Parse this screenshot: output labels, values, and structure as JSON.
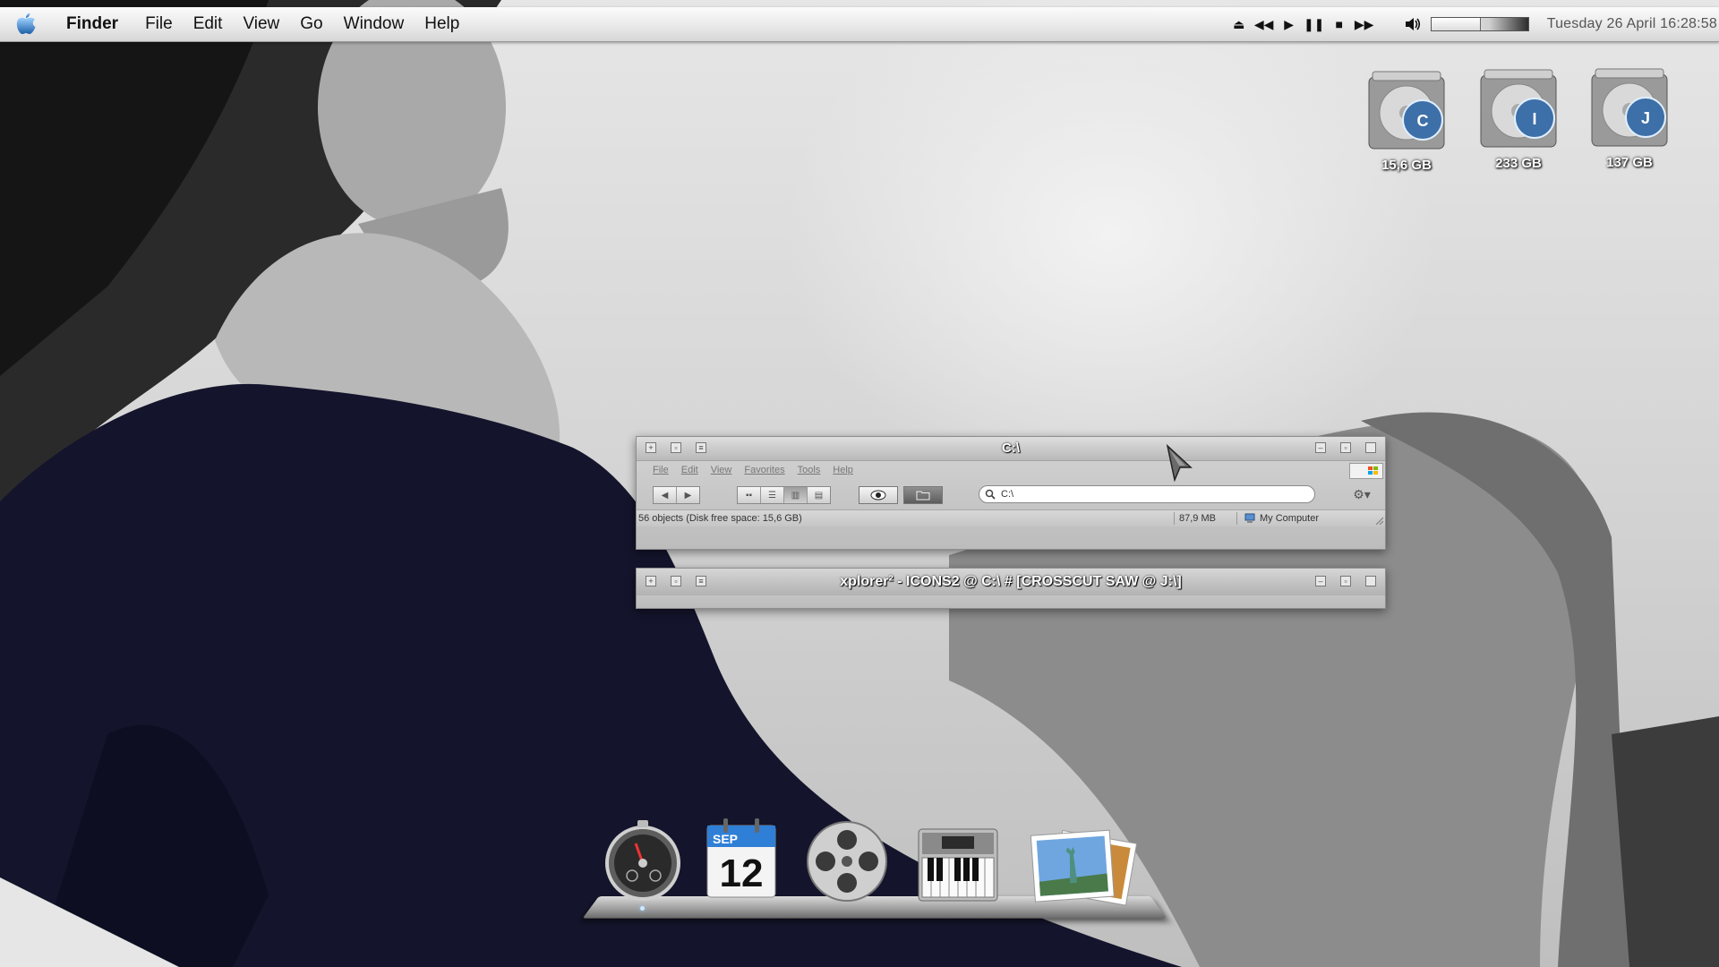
{
  "menubar": {
    "app_name": "Finder",
    "items": [
      "File",
      "Edit",
      "View",
      "Go",
      "Window",
      "Help"
    ],
    "clock": "Tuesday 26 April 16:28:58",
    "volume_level": 0.5,
    "media_controls": [
      "eject-icon",
      "rewind-icon",
      "play-icon",
      "pause-icon",
      "stop-icon",
      "fast-forward-icon"
    ]
  },
  "desktop": {
    "drives": [
      {
        "letter": "C",
        "size": "15,6 GB"
      },
      {
        "letter": "I",
        "size": "233 GB"
      },
      {
        "letter": "J",
        "size": "137 GB"
      }
    ]
  },
  "explorer": {
    "title": "C:\\",
    "menu": [
      "File",
      "Edit",
      "View",
      "Favorites",
      "Tools",
      "Help"
    ],
    "address": "C:\\",
    "status": {
      "objects": "56 objects (Disk free space: 15,6 GB)",
      "size": "87,9 MB",
      "location": "My Computer"
    }
  },
  "xplorer": {
    "title": "xplorer² - ICONS2 @ C:\\ # [CROSSCUT SAW @ J:\\]"
  },
  "dock": {
    "calendar_month": "SEP",
    "calendar_day": "12",
    "items": [
      "dashboard-icon",
      "calendar-icon",
      "film-reel-icon",
      "piano-keyboard-icon",
      "photos-icon"
    ]
  },
  "colors": {
    "menubar_bg": "#e9e9e9",
    "window_bg": "#c8c8c8",
    "dress": "#14142c"
  }
}
